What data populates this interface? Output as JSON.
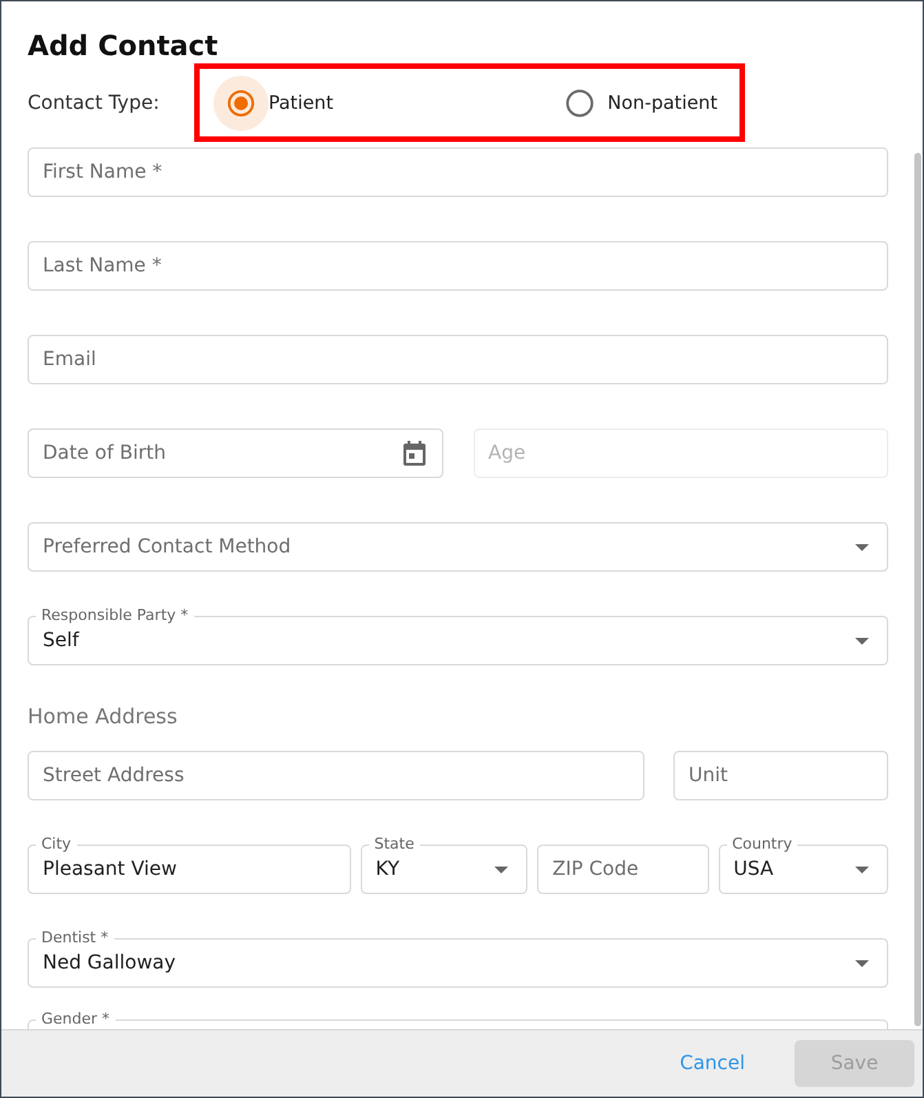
{
  "dialog": {
    "title": "Add Contact"
  },
  "contact_type": {
    "label": "Contact Type:",
    "highlighted": true,
    "options": [
      {
        "label": "Patient",
        "selected": true
      },
      {
        "label": "Non-patient",
        "selected": false
      }
    ]
  },
  "rows": [
    {
      "kind": "fields",
      "fields": [
        {
          "kind": "text",
          "placeholder": "First Name *",
          "disabled": false
        }
      ]
    },
    {
      "kind": "fields",
      "fields": [
        {
          "kind": "text",
          "placeholder": "Last Name *",
          "disabled": false
        }
      ]
    },
    {
      "kind": "fields",
      "fields": [
        {
          "kind": "text",
          "placeholder": "Email",
          "disabled": false
        }
      ]
    },
    {
      "kind": "fields",
      "fields": [
        {
          "kind": "date",
          "placeholder": "Date of Birth",
          "disabled": false
        },
        {
          "kind": "text",
          "placeholder": "Age",
          "disabled": true
        }
      ]
    },
    {
      "kind": "fields",
      "fields": [
        {
          "kind": "select",
          "placeholder": "Preferred Contact Method",
          "disabled": false
        }
      ]
    },
    {
      "kind": "fields",
      "fields": [
        {
          "kind": "select",
          "label": "Responsible Party *",
          "value": "Self",
          "disabled": false
        }
      ]
    },
    {
      "kind": "heading",
      "text": "Home Address"
    },
    {
      "kind": "fields",
      "fields": [
        {
          "kind": "text",
          "placeholder": "Street Address",
          "disabled": false
        },
        {
          "kind": "text",
          "placeholder": "Unit",
          "disabled": false
        }
      ]
    },
    {
      "kind": "fields",
      "fields": [
        {
          "kind": "text",
          "label": "City",
          "value": "Pleasant View",
          "disabled": false
        },
        {
          "kind": "select",
          "label": "State",
          "value": "KY",
          "disabled": false
        },
        {
          "kind": "text",
          "placeholder": "ZIP Code",
          "disabled": false
        },
        {
          "kind": "select",
          "label": "Country",
          "value": "USA",
          "disabled": false
        }
      ]
    },
    {
      "kind": "fields",
      "fields": [
        {
          "kind": "select",
          "label": "Dentist *",
          "value": "Ned Galloway",
          "disabled": false
        }
      ]
    },
    {
      "kind": "fields",
      "fields": [
        {
          "kind": "select",
          "label": "Gender *",
          "disabled": false
        }
      ]
    }
  ],
  "footer": {
    "buttons": [
      {
        "label": "Cancel",
        "kind": "text",
        "disabled": false
      },
      {
        "label": "Save",
        "kind": "filled",
        "disabled": true
      }
    ]
  }
}
